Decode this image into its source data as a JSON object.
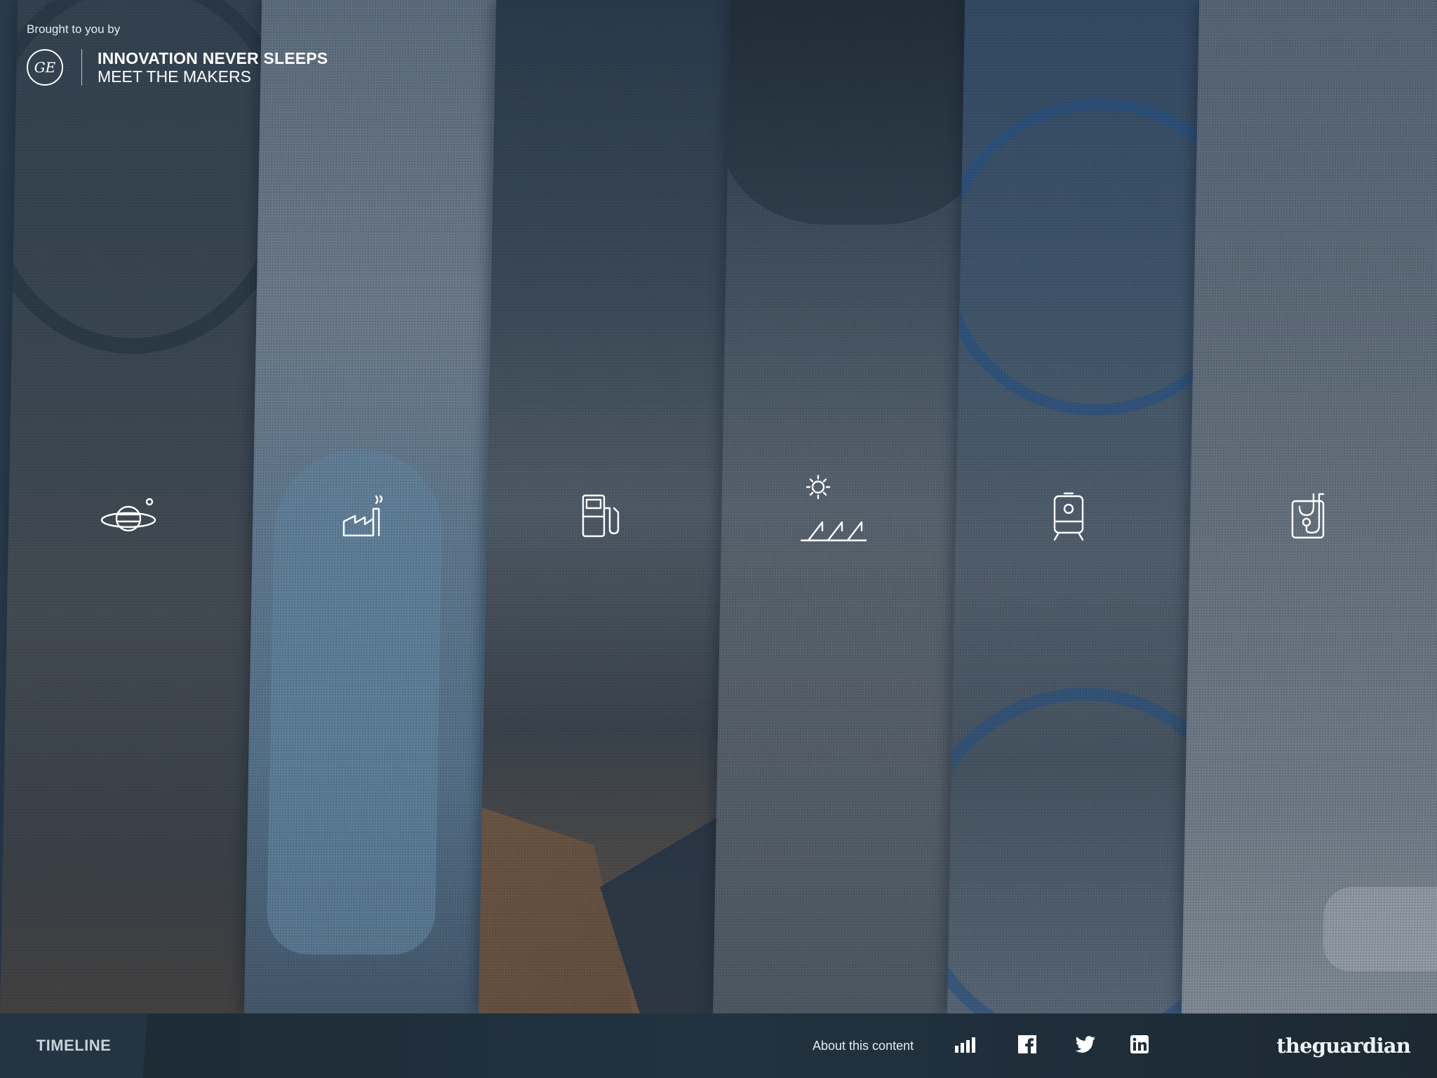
{
  "header": {
    "brought_by": "Brought to you by",
    "logo_text": "GE",
    "title": "INNOVATION NEVER SLEEPS",
    "subtitle": "MEET THE MAKERS"
  },
  "panels": [
    {
      "icon": "planet-icon"
    },
    {
      "icon": "factory-icon"
    },
    {
      "icon": "fuel-pump-icon"
    },
    {
      "icon": "solar-wind-icon"
    },
    {
      "icon": "train-icon"
    },
    {
      "icon": "medical-stethoscope-icon"
    }
  ],
  "footer": {
    "timeline_label": "TIMELINE",
    "about_label": "About this content",
    "publisher": "theguardian"
  },
  "colors": {
    "overlay": "#24384c",
    "footer_bg": "#1f2d38",
    "text": "#ffffff"
  }
}
